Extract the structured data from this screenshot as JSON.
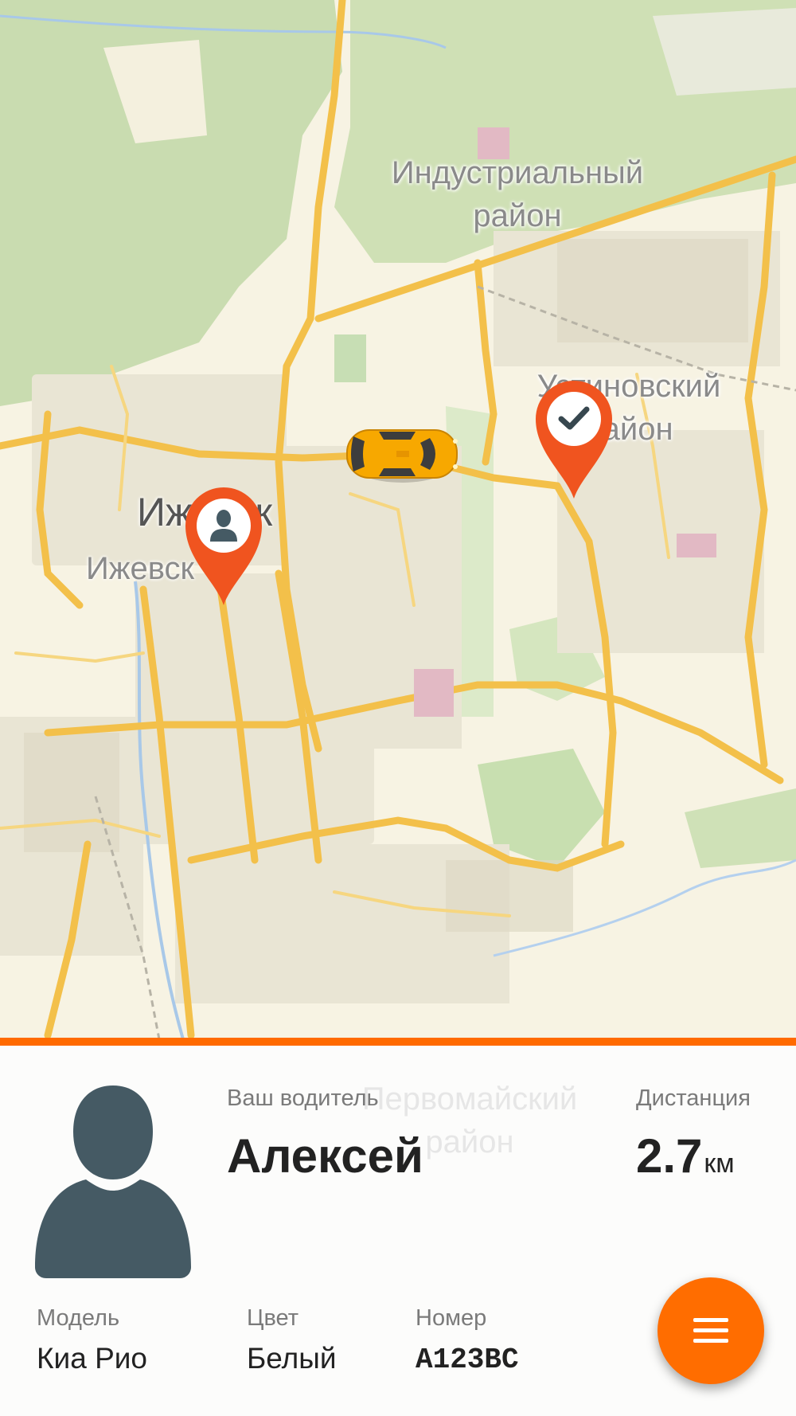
{
  "map": {
    "districts": [
      {
        "name": "Индустриальный\nрайон"
      },
      {
        "name": "Устиновский\nрайон"
      }
    ],
    "city_name": "Ижевск",
    "city_subname": "Ижевск",
    "pickup_icon": "person-icon",
    "destination_icon": "check-icon",
    "vehicle_icon": "taxi-car-icon",
    "pin_color": "#f0541f"
  },
  "panel": {
    "ghost_district": "Первомайский\nрайон",
    "driver_label": "Ваш водитель",
    "driver_name": "Алексей",
    "distance_label": "Дистанция",
    "distance_value": "2.7",
    "distance_unit": "км",
    "model_label": "Модель",
    "model_value": "Киа Рио",
    "color_label": "Цвет",
    "color_value": "Белый",
    "plate_label": "Номер",
    "plate_value": "А123ВС",
    "menu_icon": "menu-icon",
    "accent_color": "#ff6a00"
  }
}
